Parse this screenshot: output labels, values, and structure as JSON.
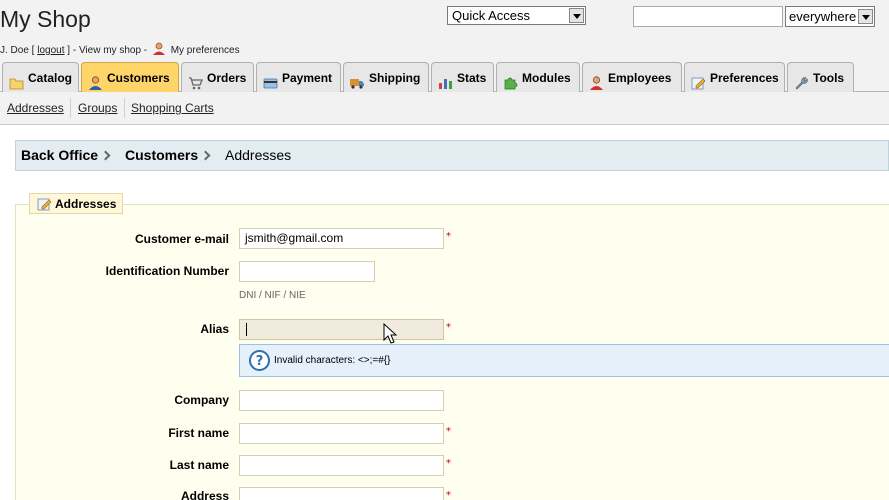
{
  "header": {
    "shop_title": "My Shop",
    "user": {
      "name": "J. Doe [",
      "logout": "logout",
      "after_logout": "] - View my shop -",
      "preferences": "My preferences"
    },
    "quick_access": "Quick Access",
    "search_value": "",
    "search_scope": "everywhere"
  },
  "tabs": [
    {
      "label": "Catalog",
      "icon": "folder-icon"
    },
    {
      "label": "Customers",
      "icon": "person-icon",
      "active": true
    },
    {
      "label": "Orders",
      "icon": "cart-icon"
    },
    {
      "label": "Payment",
      "icon": "card-icon"
    },
    {
      "label": "Shipping",
      "icon": "truck-icon"
    },
    {
      "label": "Stats",
      "icon": "chart-icon"
    },
    {
      "label": "Modules",
      "icon": "puzzle-icon"
    },
    {
      "label": "Employees",
      "icon": "employee-icon"
    },
    {
      "label": "Preferences",
      "icon": "pencil-icon"
    },
    {
      "label": "Tools",
      "icon": "wrench-icon"
    }
  ],
  "subtabs": [
    "Addresses",
    "Groups",
    "Shopping Carts"
  ],
  "breadcrumb": [
    "Back Office",
    "Customers",
    "Addresses"
  ],
  "form": {
    "legend": "Addresses",
    "email_label": "Customer e-mail",
    "email_value": "jsmith@gmail.com",
    "id_label": "Identification Number",
    "id_value": "",
    "id_hint": "DNI / NIF / NIE",
    "alias_label": "Alias",
    "alias_value": "",
    "alias_hint": "Invalid characters: <>;=#{}",
    "company_label": "Company",
    "firstname_label": "First name",
    "lastname_label": "Last name",
    "address_label": "Address",
    "required_mark": "*"
  },
  "colors": {
    "active_tab": "#ffd56a",
    "breadcrumb_bg": "#e3ecf0",
    "form_bg": "#fffff0",
    "hint_bg": "#e5f0fb",
    "required": "#cc0000"
  }
}
